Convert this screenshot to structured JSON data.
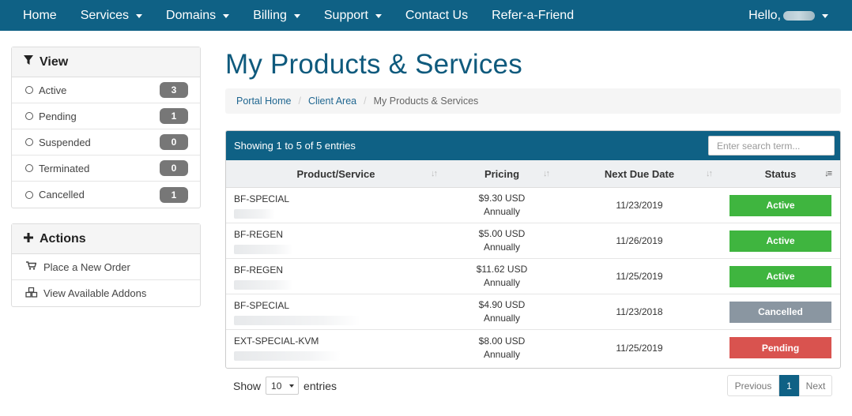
{
  "nav": {
    "items": [
      {
        "label": "Home",
        "dropdown": false
      },
      {
        "label": "Services",
        "dropdown": true
      },
      {
        "label": "Domains",
        "dropdown": true
      },
      {
        "label": "Billing",
        "dropdown": true
      },
      {
        "label": "Support",
        "dropdown": true
      },
      {
        "label": "Contact Us",
        "dropdown": false
      },
      {
        "label": "Refer-a-Friend",
        "dropdown": false
      }
    ],
    "greeting": "Hello,"
  },
  "sidebar": {
    "view": {
      "title": "View",
      "icon": "filter-icon",
      "items": [
        {
          "label": "Active",
          "count": "3"
        },
        {
          "label": "Pending",
          "count": "1"
        },
        {
          "label": "Suspended",
          "count": "0"
        },
        {
          "label": "Terminated",
          "count": "0"
        },
        {
          "label": "Cancelled",
          "count": "1"
        }
      ]
    },
    "actions": {
      "title": "Actions",
      "icon": "plus-icon",
      "items": [
        {
          "label": "Place a New Order",
          "icon": "cart-icon"
        },
        {
          "label": "View Available Addons",
          "icon": "cubes-icon"
        }
      ]
    }
  },
  "page": {
    "title": "My Products & Services",
    "breadcrumb": [
      "Portal Home",
      "Client Area",
      "My Products & Services"
    ]
  },
  "table": {
    "info": "Showing 1 to 5 of 5 entries",
    "search_placeholder": "Enter search term...",
    "columns": [
      "Product/Service",
      "Pricing",
      "Next Due Date",
      "Status"
    ],
    "rows": [
      {
        "product": "BF-SPECIAL",
        "price": "$9.30 USD",
        "cycle": "Annually",
        "due": "11/23/2019",
        "status": "Active",
        "color": "#3fb53f"
      },
      {
        "product": "BF-REGEN",
        "price": "$5.00 USD",
        "cycle": "Annually",
        "due": "11/26/2019",
        "status": "Active",
        "color": "#3fb53f"
      },
      {
        "product": "BF-REGEN",
        "price": "$11.62 USD",
        "cycle": "Annually",
        "due": "11/25/2019",
        "status": "Active",
        "color": "#3fb53f"
      },
      {
        "product": "BF-SPECIAL",
        "price": "$4.90 USD",
        "cycle": "Annually",
        "due": "11/23/2018",
        "status": "Cancelled",
        "color": "#8a96a1"
      },
      {
        "product": "EXT-SPECIAL-KVM",
        "price": "$8.00 USD",
        "cycle": "Annually",
        "due": "11/25/2019",
        "status": "Pending",
        "color": "#d9534f"
      }
    ]
  },
  "footer": {
    "show_label": "Show",
    "page_size": "10",
    "entries_label": "entries"
  },
  "pager": {
    "prev": "Previous",
    "current": "1",
    "next": "Next"
  },
  "colors": {
    "nav": "#0f6185",
    "title": "#0f5a7d",
    "active": "#3fb53f",
    "cancelled": "#8a96a1",
    "pending": "#d9534f"
  }
}
